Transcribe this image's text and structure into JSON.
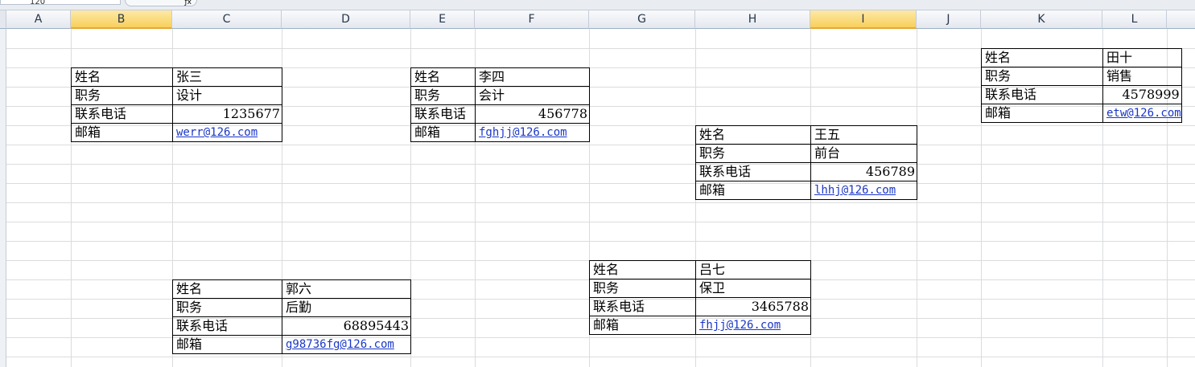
{
  "name_box": "120",
  "columns": [
    "A",
    "B",
    "C",
    "D",
    "E",
    "F",
    "G",
    "H",
    "I",
    "J",
    "K",
    "L"
  ],
  "selected_columns": [
    "B",
    "I"
  ],
  "labels": {
    "name": "姓名",
    "title": "职务",
    "phone": "联系电话",
    "email": "邮箱"
  },
  "cards": [
    {
      "name": "张三",
      "title": "设计",
      "phone": "1235677",
      "email": "werr@126.com"
    },
    {
      "name": "李四",
      "title": "会计",
      "phone": "456778",
      "email": "fghjj@126.com"
    },
    {
      "name": "田十",
      "title": "销售",
      "phone": "4578999",
      "email": "etw@126.com"
    },
    {
      "name": "王五",
      "title": "前台",
      "phone": "456789",
      "email": "lhhj@126.com"
    },
    {
      "name": "郭六",
      "title": "后勤",
      "phone": "68895443",
      "email": "g98736fg@126.com"
    },
    {
      "name": "吕七",
      "title": "保卫",
      "phone": "3465788",
      "email": "fhjj@126.com"
    }
  ]
}
